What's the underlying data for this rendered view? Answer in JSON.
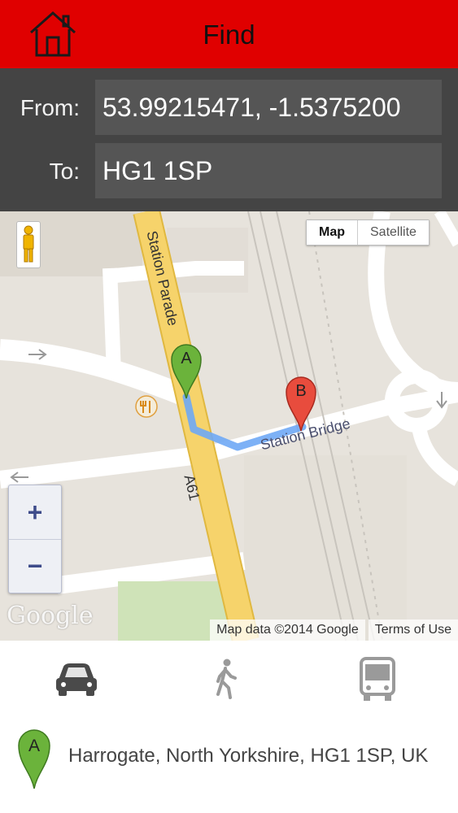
{
  "header": {
    "title": "Find",
    "home_icon": "home-icon"
  },
  "form": {
    "from_label": "From:",
    "from_value": "53.99215471, -1.5375200",
    "to_label": "To:",
    "to_value": "HG1 1SP"
  },
  "map": {
    "map_type": {
      "map_label": "Map",
      "satellite_label": "Satellite",
      "selected": "Map"
    },
    "zoom_in_label": "+",
    "zoom_out_label": "−",
    "road_labels": {
      "station_parade": "Station Parade",
      "a61": "A61",
      "station_bridge": "Station Bridge"
    },
    "marker_a_label": "A",
    "marker_b_label": "B",
    "logo_text": "Google",
    "attribution": "Map data ©2014 Google",
    "terms": "Terms of Use",
    "colors": {
      "route": "#6fa8f5",
      "major_road": "#f6d36b",
      "marker_a": "#6bb33b",
      "marker_b": "#e84c3d"
    }
  },
  "travel_modes": [
    {
      "name": "car",
      "icon": "car-icon",
      "selected": true
    },
    {
      "name": "walk",
      "icon": "walk-icon",
      "selected": false
    },
    {
      "name": "bus",
      "icon": "bus-icon",
      "selected": false
    }
  ],
  "result": {
    "marker_label": "A",
    "address": "Harrogate, North Yorkshire, HG1 1SP, UK"
  },
  "colors": {
    "header_bg": "#e00000",
    "form_bg": "#444444",
    "field_bg": "#555555"
  }
}
